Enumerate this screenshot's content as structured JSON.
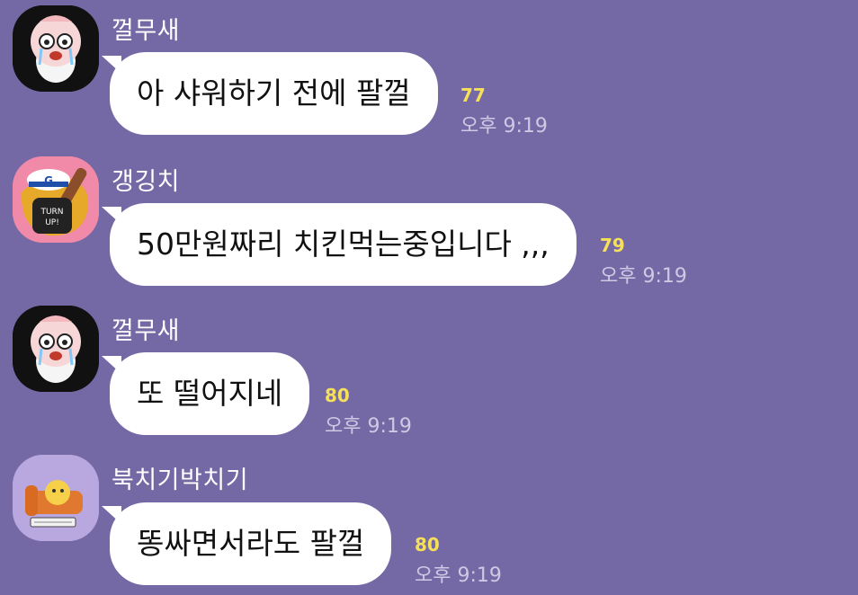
{
  "messages": [
    {
      "sender": "껄무새",
      "text": "아 샤워하기 전에 팔껄",
      "unread": "77",
      "time": "오후 9:19",
      "avatar": "crying-peach-avatar"
    },
    {
      "sender": "갱깅치",
      "text": "50만원짜리 치킨먹는중입니다 ,,,",
      "unread": "79",
      "time": "오후 9:19",
      "avatar": "turn-up-lion-avatar"
    },
    {
      "sender": "껄무새",
      "text": "또 떨어지네",
      "unread": "80",
      "time": "오후 9:19",
      "avatar": "crying-peach-avatar"
    },
    {
      "sender": "북치기박치기",
      "text": "똥싸면서라도 팔껄",
      "unread": "80",
      "time": "오후 9:19",
      "avatar": "sleeping-cat-avatar"
    }
  ],
  "colors": {
    "background": "#7569a5",
    "bubble": "#ffffff",
    "unread": "#f6e05a",
    "time": "#cfc9e4"
  }
}
